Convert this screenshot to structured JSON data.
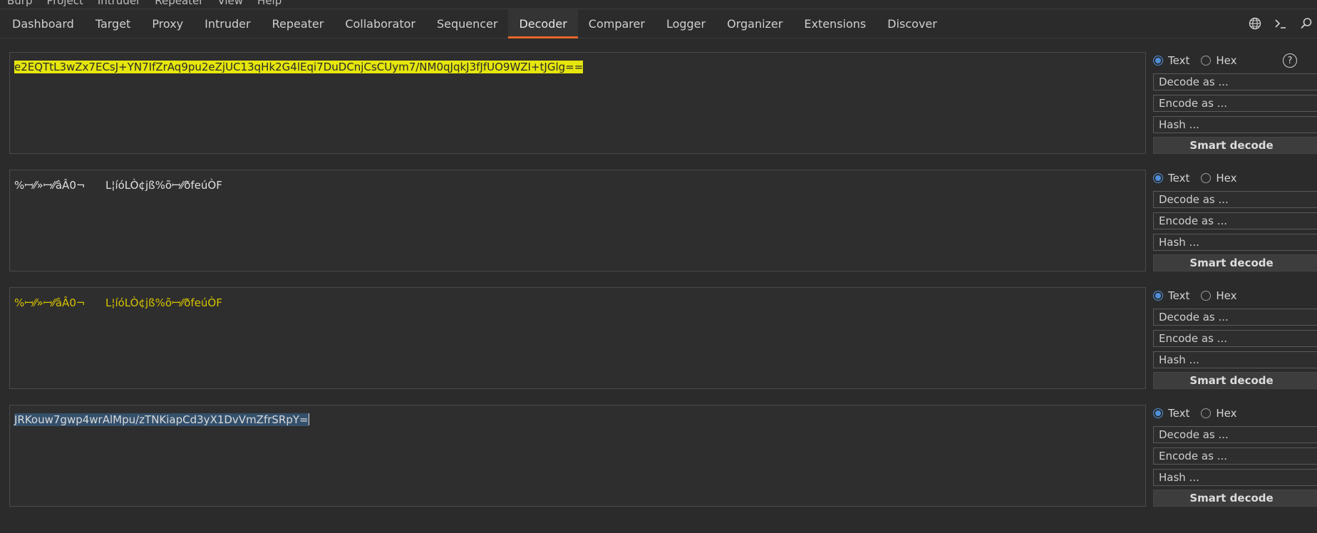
{
  "menu": [
    "Burp",
    "Project",
    "Intruder",
    "Repeater",
    "View",
    "Help"
  ],
  "tabs": [
    "Dashboard",
    "Target",
    "Proxy",
    "Intruder",
    "Repeater",
    "Collaborator",
    "Sequencer",
    "Decoder",
    "Comparer",
    "Logger",
    "Organizer",
    "Extensions",
    "Discover"
  ],
  "active_tab": "Decoder",
  "accent_color": "#e5672b",
  "icons": [
    "globe-icon",
    "terminal-icon",
    "search-icon"
  ],
  "panels": [
    {
      "text": "e2EQTtL3wZx7ECsJ+YN7IfZrAq9pu2eZjUC13qHk2G4lEqi7DuDCnjCsCUym7/NM0qJqkJ3fJfUO9WZI+tJGlg==",
      "style": "yellow-highlight",
      "format_text": "Text",
      "format_hex": "Hex",
      "selected": "Text",
      "decode": "Decode as ...",
      "encode": "Encode as ...",
      "hash": "Hash ...",
      "smart": "Smart decode",
      "help": "?"
    },
    {
      "text": "%ꟷ⁄⁄»ꟷ⁄⁄âÂ0¬      L¦íóLÒ¢jß%õꟷ⁄⁄ðfeúÒF",
      "style": "plain",
      "format_text": "Text",
      "format_hex": "Hex",
      "selected": "Text",
      "decode": "Decode as ...",
      "encode": "Encode as ...",
      "hash": "Hash ...",
      "smart": "Smart decode"
    },
    {
      "text": "%ꟷ⁄⁄»ꟷ⁄⁄âÂ0¬      L¦íóLÒ¢jß%õꟷ⁄⁄ðfeúÒF",
      "style": "yellow-text",
      "format_text": "Text",
      "format_hex": "Hex",
      "selected": "Text",
      "decode": "Decode as ...",
      "encode": "Encode as ...",
      "hash": "Hash ...",
      "smart": "Smart decode"
    },
    {
      "text": "JRKouw7gwp4wrAlMpu/zTNKiapCd3yX1DvVmZfrSRpY=",
      "style": "blue-selection",
      "format_text": "Text",
      "format_hex": "Hex",
      "selected": "Text",
      "decode": "Decode as ...",
      "encode": "Encode as ...",
      "hash": "Hash ...",
      "smart": "Smart decode"
    }
  ]
}
